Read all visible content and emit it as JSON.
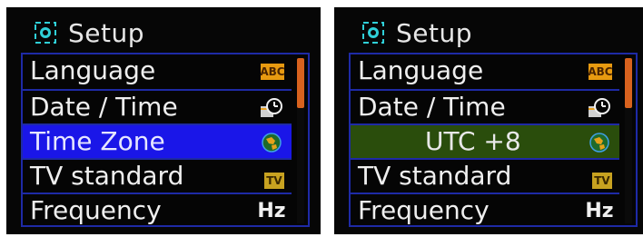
{
  "screens": [
    {
      "title": "Setup",
      "items": [
        {
          "label": "Language",
          "icon_text": "ABC",
          "icon": "language-icon"
        },
        {
          "label": "Date / Time",
          "icon": "clock-icon"
        },
        {
          "label": "Time Zone",
          "icon": "globe-icon"
        },
        {
          "label": "TV standard",
          "icon_text": "TV",
          "icon": "tv-icon"
        },
        {
          "label": "Frequency",
          "icon_text": "Hz",
          "icon": "frequency-icon"
        }
      ],
      "selected_index": 2,
      "selection_color": "#1a16e8",
      "scroll_fraction": 0.3
    },
    {
      "title": "Setup",
      "items": [
        {
          "label": "Language",
          "icon_text": "ABC",
          "icon": "language-icon"
        },
        {
          "label": "Date / Time",
          "icon": "clock-icon"
        },
        {
          "label": "UTC +8",
          "icon": "globe-icon"
        },
        {
          "label": "TV standard",
          "icon_text": "TV",
          "icon": "tv-icon"
        },
        {
          "label": "Frequency",
          "icon_text": "Hz",
          "icon": "frequency-icon"
        }
      ],
      "selected_index": 2,
      "selection_color": "#2a4d0c",
      "scroll_fraction": 0.3
    }
  ],
  "colors": {
    "background": "#060606",
    "menu_border": "#1e2aa6",
    "scroll_thumb": "#d8621e",
    "icon_orange": "#e89a10"
  }
}
